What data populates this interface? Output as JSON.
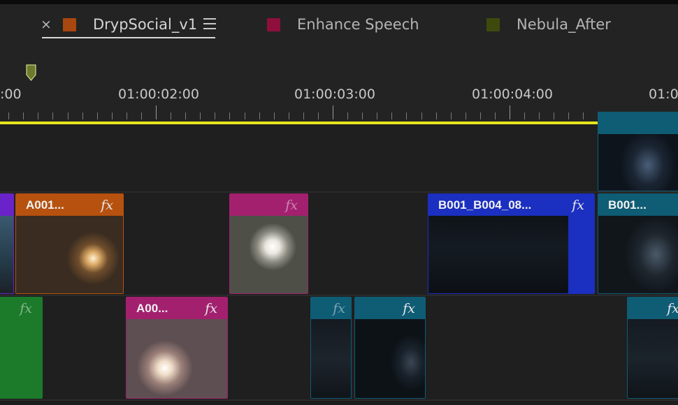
{
  "tabs": [
    {
      "label": "DrypSocial_v1",
      "color": "#a8470f",
      "active": true
    },
    {
      "label": "Enhance Speech",
      "color": "#8e0f3c",
      "active": false
    },
    {
      "label": "Nebula_After",
      "color": "#3e4a0c",
      "active": false
    }
  ],
  "close_glyph": "×",
  "ruler": {
    "timecodes": [
      ":00",
      "01:00:02:00",
      "01:00:03:00",
      "01:00:04:00",
      "01:0"
    ],
    "playhead_color": "#e9e51d"
  },
  "clips": {
    "v3_teal_name": "",
    "v2_purple_name": "",
    "v2_orange_name": "A001...",
    "v2_magenta_name": "",
    "v2_blue_name": "B001_B004_08...",
    "v2_teal_name": "B001...",
    "v1_green_name": "",
    "v1_magenta_name": "A00...",
    "v1_teal_small_name": "",
    "v1_teal_name": "",
    "v1_teal_right_name": "",
    "fx": "fx"
  },
  "colors": {
    "orange": "#b6510f",
    "magenta": "#a3206f",
    "blue": "#1b2fc0",
    "teal": "#0f5c75",
    "green": "#1c7a2b",
    "purple": "#6a22c9"
  }
}
